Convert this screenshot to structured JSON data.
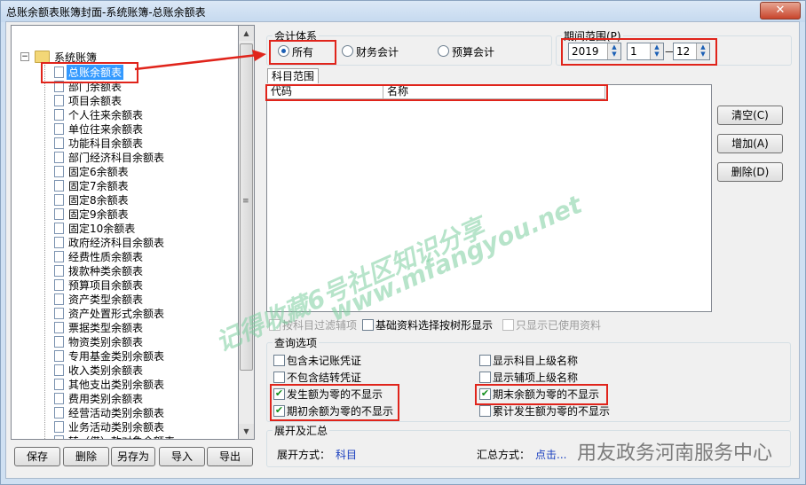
{
  "window": {
    "title": "总账余额表账簿封面-系统账簿-总账余额表",
    "close_label": "✕"
  },
  "tree": {
    "root_label": "系统账簿",
    "items": [
      "总账余额表",
      "部门余额表",
      "项目余额表",
      "个人往来余额表",
      "单位往来余额表",
      "功能科目余额表",
      "部门经济科目余额表",
      "固定6余额表",
      "固定7余额表",
      "固定8余额表",
      "固定9余额表",
      "固定10余额表",
      "政府经济科目余额表",
      "经费性质余额表",
      "拨款种类余额表",
      "预算项目余额表",
      "资产类型余额表",
      "资产处置形式余额表",
      "票据类型余额表",
      "物资类别余额表",
      "专用基金类别余额表",
      "收入类别余额表",
      "其他支出类别余额表",
      "费用类别余额表",
      "经营活动类别余额表",
      "业务活动类别余额表",
      "转（借）款对象余额表"
    ]
  },
  "bottom_buttons": {
    "save": "保存",
    "delete": "删除",
    "save_as": "另存为",
    "import": "导入",
    "export": "导出"
  },
  "accounting_system": {
    "legend": "会计体系",
    "options": [
      "所有",
      "财务会计",
      "预算会计"
    ],
    "selected": "所有"
  },
  "period": {
    "legend": "期间范围(P)",
    "year": "2019",
    "from": "1",
    "separator": "－",
    "to": "12"
  },
  "subject_range": {
    "tab": "科目范围",
    "columns": [
      "代码",
      "名称"
    ]
  },
  "side_buttons": {
    "clear": "清空(C)",
    "add": "增加(A)",
    "remove": "删除(D)"
  },
  "filter_row": {
    "by_subject_aux": "按科目过滤辅项",
    "tree_display": "基础资料选择按树形显示",
    "only_used": "只显示已使用资料"
  },
  "query_options": {
    "legend": "查询选项",
    "left": [
      {
        "label": "包含未记账凭证",
        "checked": false
      },
      {
        "label": "不包含结转凭证",
        "checked": false
      },
      {
        "label": "发生额为零的不显示",
        "checked": true
      },
      {
        "label": "期初余额为零的不显示",
        "checked": true
      }
    ],
    "right": [
      {
        "label": "显示科目上级名称",
        "checked": false
      },
      {
        "label": "显示辅项上级名称",
        "checked": false
      },
      {
        "label": "期末余额为零的不显示",
        "checked": true
      },
      {
        "label": "累计发生额为零的不显示",
        "checked": false
      }
    ]
  },
  "expand_summary": {
    "legend": "展开及汇总",
    "expand_label": "展开方式：",
    "expand_value": "科目",
    "summary_label": "汇总方式：",
    "summary_value": "点击..."
  },
  "watermark": {
    "line1": "记得收藏6号社区知识分享",
    "line2": "www.mfangyou.net",
    "footer": "用友政务河南服务中心"
  },
  "colors": {
    "highlight": "#e0241b",
    "selection": "#3399ff",
    "link": "#1a3fbf"
  }
}
